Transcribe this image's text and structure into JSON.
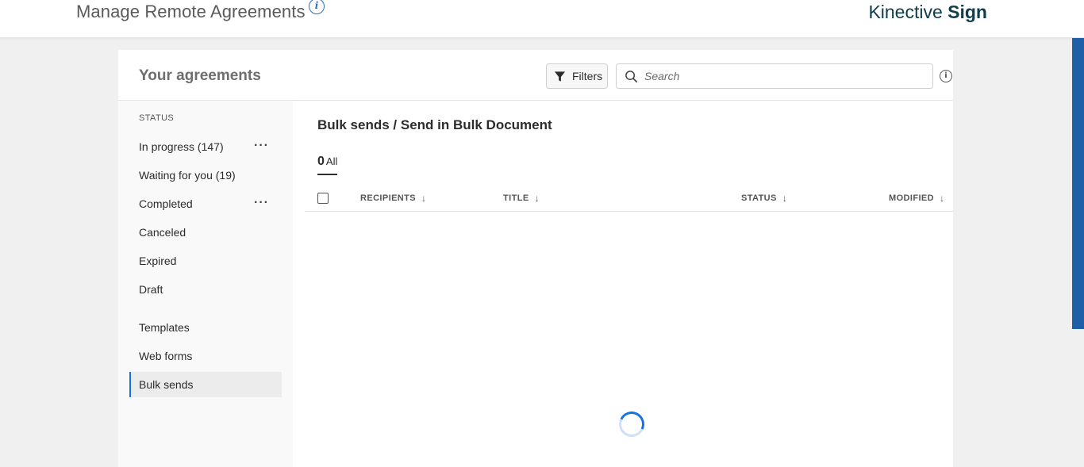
{
  "header": {
    "page_title": "Manage Remote Agreements",
    "brand_light": "Kinective",
    "brand_bold": "Sign"
  },
  "card": {
    "title": "Your agreements",
    "filters_label": "Filters",
    "search_placeholder": "Search"
  },
  "sidebar": {
    "status_heading": "STATUS",
    "items": [
      {
        "label": "In progress (147)"
      },
      {
        "label": "Waiting for you (19)"
      },
      {
        "label": "Completed"
      },
      {
        "label": "Canceled"
      },
      {
        "label": "Expired"
      },
      {
        "label": "Draft"
      },
      {
        "label": "Templates"
      },
      {
        "label": "Web forms"
      },
      {
        "label": "Bulk sends"
      }
    ],
    "more_glyph": "···"
  },
  "main": {
    "breadcrumb": "Bulk sends / Send in Bulk Document",
    "tab_count": "0",
    "tab_label": "All",
    "columns": [
      {
        "label": "RECIPIENTS"
      },
      {
        "label": "TITLE"
      },
      {
        "label": "STATUS"
      },
      {
        "label": "MODIFIED"
      }
    ]
  },
  "colors": {
    "accent": "#1473e6",
    "brand": "#0f3d4c",
    "scrollbar": "#1e5fa8"
  },
  "icons": {
    "info": "info-icon",
    "filter": "filter-icon",
    "search": "search-icon",
    "sort": "arrow-down-icon",
    "loading": "spinner-icon"
  }
}
